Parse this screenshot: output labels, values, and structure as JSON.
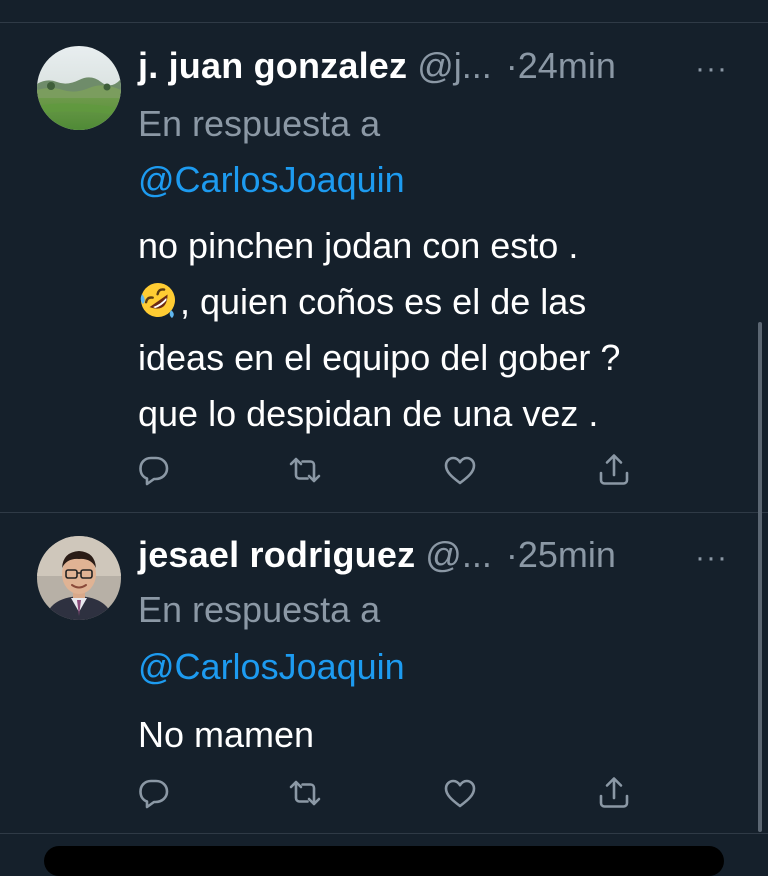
{
  "theme": {
    "background": "#15202b",
    "text": "#ffffff",
    "muted": "#8b98a5",
    "accent": "#1d9bf0",
    "divider": "#2f3a46"
  },
  "tweets": [
    {
      "name": "j. juan gonzalez",
      "handle": "@j...",
      "time": "·24min",
      "more": "···",
      "replying_label": "En respuesta a",
      "reply_to": "@CarlosJoaquin",
      "lines": [
        "no pinchen jodan con esto .",
        ", quien coños es el de las",
        "ideas en el equipo del gober ?",
        "que lo despidan de una vez ."
      ],
      "emoji": "rolling-on-floor-laughing-emoji",
      "avatar": "landscape-avatar",
      "actions": [
        "reply-icon",
        "retweet-icon",
        "like-icon",
        "share-icon"
      ]
    },
    {
      "name": "jesael rodriguez",
      "handle": "@...",
      "time": "·25min",
      "more": "···",
      "replying_label": "En respuesta a",
      "reply_to": "@CarlosJoaquin",
      "lines": [
        "No mamen"
      ],
      "avatar": "person-avatar",
      "actions": [
        "reply-icon",
        "retweet-icon",
        "like-icon",
        "share-icon"
      ]
    }
  ]
}
